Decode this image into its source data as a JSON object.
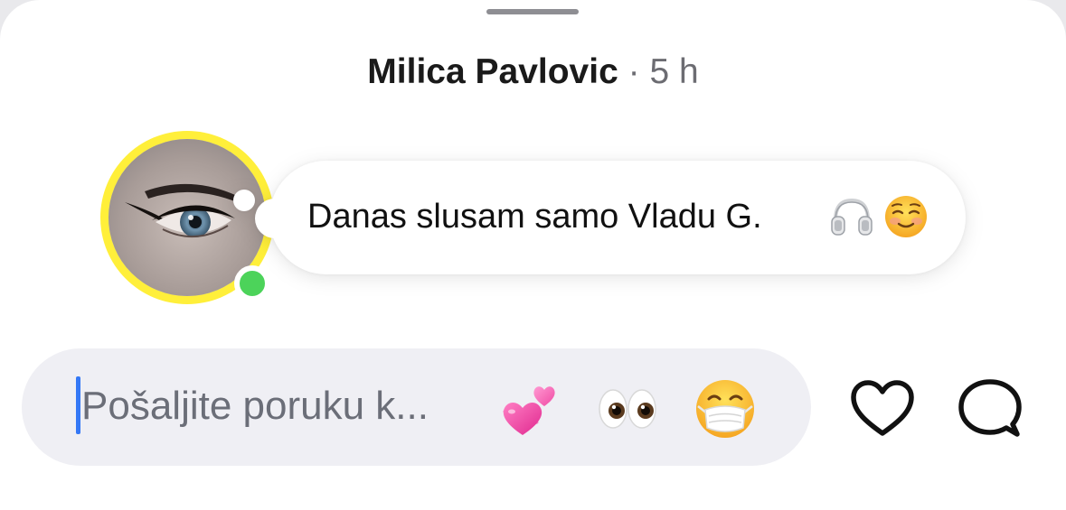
{
  "header": {
    "author_name": "Milica Pavlovic",
    "separator": "·",
    "time": "5 h"
  },
  "story": {
    "avatar": "profile-photo",
    "ring_color": "#ffef3a",
    "online_indicator_color": "#4cd35a",
    "note": {
      "text": "Danas slusam samo Vladu G.",
      "emojis": [
        "headphones-emoji",
        "smiling-face-emoji"
      ]
    }
  },
  "composer": {
    "placeholder": "Pošaljite poruku k...",
    "value": "",
    "caret_color": "#3478f6",
    "quick_reactions": [
      {
        "icon": "revolving-hearts-emoji",
        "char": "💞"
      },
      {
        "icon": "eyes-emoji",
        "char": "👀"
      },
      {
        "icon": "face-with-medical-mask-emoji",
        "char": "😷"
      }
    ]
  },
  "actions": [
    {
      "icon": "heart-outline-icon",
      "label": "Like"
    },
    {
      "icon": "speech-bubble-icon",
      "label": "Reply"
    }
  ]
}
